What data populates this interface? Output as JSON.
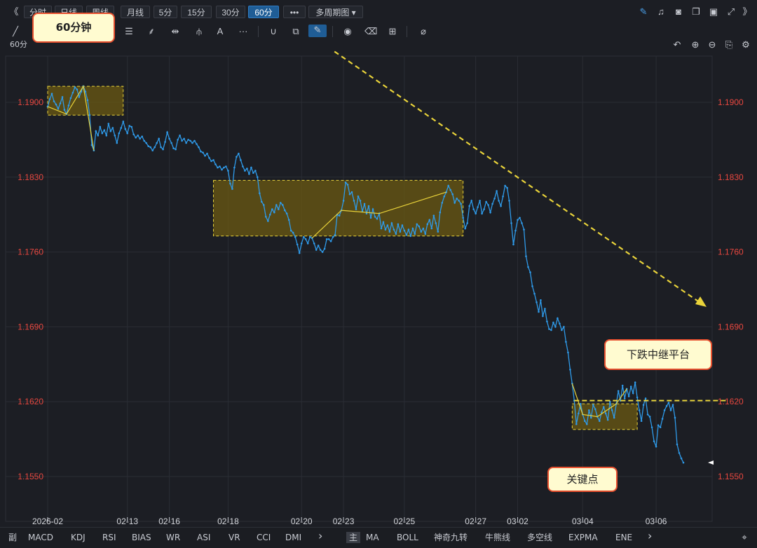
{
  "toolbar": {
    "collapse_label": "《",
    "periods": [
      {
        "label": "分时",
        "active": false
      },
      {
        "label": "日线",
        "active": false
      },
      {
        "label": "周线",
        "active": false
      },
      {
        "label": "月线",
        "active": false
      },
      {
        "label": "5分",
        "active": false
      },
      {
        "label": "15分",
        "active": false
      },
      {
        "label": "30分",
        "active": false
      },
      {
        "label": "60分",
        "active": true
      }
    ],
    "more_label": "•••",
    "multi_period_label": "多周期图 ▾",
    "expand_label": "》"
  },
  "drawing_tools": [
    "line-tool-icon",
    "fib-tool-icon",
    "gann-tool-icon",
    "measure-tool-icon",
    "pitchfork-tool-icon",
    "text-tool-icon",
    "more-tools-icon",
    "magnet-icon",
    "layer-icon",
    "pen-icon",
    "eye-icon",
    "trash-icon",
    "grid-icon",
    "ruler-icon"
  ],
  "info": {
    "period_label": "60分"
  },
  "callouts": {
    "timeframe": "60分钟",
    "relay": "下跌中继平台",
    "key_point": "关键点"
  },
  "indicators": {
    "sub_label": "副",
    "sub": [
      "MACD",
      "KDJ",
      "RSI",
      "BIAS",
      "WR",
      "ASI",
      "VR",
      "CCI",
      "DMI"
    ],
    "main_label": "主",
    "main": [
      "MA",
      "BOLL",
      "神奇九转",
      "牛熊线",
      "多空线",
      "EXPMA",
      "ENE"
    ],
    "next_symbol": "›"
  },
  "colors": {
    "price_line": "#2f9bea",
    "axis_label": "#e8473f",
    "annotation": "#e9d33a",
    "box_fill": "#6b5a12",
    "background": "#1c1e24"
  },
  "chart_data": {
    "type": "line",
    "title": "",
    "y_ticks": [
      "1.1900",
      "1.1830",
      "1.1760",
      "1.1690",
      "1.1620",
      "1.1550"
    ],
    "ylim": [
      1.1536,
      1.1924
    ],
    "x_ticks": [
      {
        "label": "2026-02",
        "i": 0
      },
      {
        "label": "02-13",
        "i": 38
      },
      {
        "label": "02-16",
        "i": 58
      },
      {
        "label": "02-18",
        "i": 86
      },
      {
        "label": "02-20",
        "i": 121
      },
      {
        "label": "02-23",
        "i": 141
      },
      {
        "label": "02-25",
        "i": 170
      },
      {
        "label": "02-27",
        "i": 204
      },
      {
        "label": "03-02",
        "i": 224
      },
      {
        "label": "03-04",
        "i": 255
      },
      {
        "label": "03-06",
        "i": 290
      }
    ],
    "series": [
      {
        "values": [
          1.1896,
          1.1903,
          1.1908,
          1.1901,
          1.1898,
          1.1894,
          1.1899,
          1.1905,
          1.1893,
          1.1889,
          1.1897,
          1.1904,
          1.1909,
          1.1914,
          1.1912,
          1.1905,
          1.191,
          1.1915,
          1.191,
          1.1902,
          1.1888,
          1.186,
          1.1855,
          1.1873,
          1.1869,
          1.1877,
          1.1871,
          1.1874,
          1.1869,
          1.188,
          1.1873,
          1.1876,
          1.1869,
          1.1862,
          1.1871,
          1.1876,
          1.1882,
          1.1875,
          1.1871,
          1.1878,
          1.1877,
          1.187,
          1.1867,
          1.1869,
          1.1866,
          1.1868,
          1.1864,
          1.1862,
          1.1859,
          1.1858,
          1.1855,
          1.1858,
          1.1862,
          1.1866,
          1.1858,
          1.1856,
          1.1863,
          1.1872,
          1.1866,
          1.1862,
          1.1857,
          1.1856,
          1.1865,
          1.1869,
          1.1864,
          1.1866,
          1.1862,
          1.1865,
          1.1864,
          1.1862,
          1.1864,
          1.1861,
          1.1858,
          1.1854,
          1.1853,
          1.185,
          1.1852,
          1.1848,
          1.1845,
          1.1846,
          1.1842,
          1.1839,
          1.184,
          1.1837,
          1.1839,
          1.184,
          1.1836,
          1.1824,
          1.1819,
          1.1839,
          1.1849,
          1.1852,
          1.1846,
          1.184,
          1.1836,
          1.1838,
          1.1833,
          1.1839,
          1.1834,
          1.1836,
          1.183,
          1.1815,
          1.1807,
          1.1804,
          1.1793,
          1.1789,
          1.1795,
          1.18,
          1.1797,
          1.1804,
          1.18,
          1.1806,
          1.1804,
          1.1799,
          1.1796,
          1.179,
          1.178,
          1.1778,
          1.1774,
          1.1767,
          1.1759,
          1.1768,
          1.1774,
          1.1772,
          1.1768,
          1.1774,
          1.1773,
          1.1768,
          1.1762,
          1.1766,
          1.1762,
          1.176,
          1.1763,
          1.1772,
          1.1772,
          1.177,
          1.1774,
          1.1776,
          1.1795,
          1.1794,
          1.1799,
          1.1808,
          1.1825,
          1.1823,
          1.1814,
          1.1816,
          1.1808,
          1.18,
          1.1812,
          1.1808,
          1.1798,
          1.1805,
          1.1796,
          1.1803,
          1.1792,
          1.18,
          1.1793,
          1.1791,
          1.1796,
          1.1782,
          1.1788,
          1.1781,
          1.1785,
          1.1779,
          1.1787,
          1.1781,
          1.1777,
          1.1786,
          1.1779,
          1.1785,
          1.178,
          1.1776,
          1.1781,
          1.1775,
          1.1782,
          1.1777,
          1.1786,
          1.1784,
          1.1779,
          1.1782,
          1.1777,
          1.1786,
          1.179,
          1.1782,
          1.1794,
          1.1787,
          1.1779,
          1.1797,
          1.1806,
          1.1812,
          1.1816,
          1.1822,
          1.1818,
          1.1814,
          1.1806,
          1.181,
          1.1808,
          1.1805,
          1.1792,
          1.1782,
          1.1787,
          1.1803,
          1.1808,
          1.18,
          1.1796,
          1.1802,
          1.1808,
          1.1796,
          1.18,
          1.1807,
          1.1804,
          1.1797,
          1.1805,
          1.181,
          1.1817,
          1.1808,
          1.1803,
          1.1812,
          1.1822,
          1.182,
          1.1808,
          1.1787,
          1.1767,
          1.178,
          1.179,
          1.1792,
          1.1787,
          1.1781,
          1.1756,
          1.1746,
          1.1741,
          1.1728,
          1.1721,
          1.1713,
          1.1704,
          1.1715,
          1.17,
          1.1707,
          1.1695,
          1.1688,
          1.1687,
          1.1694,
          1.169,
          1.1698,
          1.1693,
          1.1687,
          1.169,
          1.1676,
          1.1666,
          1.165,
          1.1637,
          1.1621,
          1.1599,
          1.1609,
          1.1618,
          1.1608,
          1.1602,
          1.1599,
          1.1612,
          1.1605,
          1.1617,
          1.1613,
          1.1606,
          1.1602,
          1.161,
          1.1615,
          1.1609,
          1.1603,
          1.162,
          1.1612,
          1.1605,
          1.1618,
          1.163,
          1.1621,
          1.1635,
          1.1623,
          1.1632,
          1.1625,
          1.1634,
          1.1628,
          1.1638,
          1.1624,
          1.1612,
          1.1602,
          1.1617,
          1.1623,
          1.1608,
          1.1606,
          1.1596,
          1.1583,
          1.1578,
          1.1598,
          1.1596,
          1.1604,
          1.1612,
          1.1616,
          1.1619,
          1.1612,
          1.1617,
          1.1605,
          1.158,
          1.1572,
          1.1567,
          1.1563
        ]
      }
    ]
  }
}
